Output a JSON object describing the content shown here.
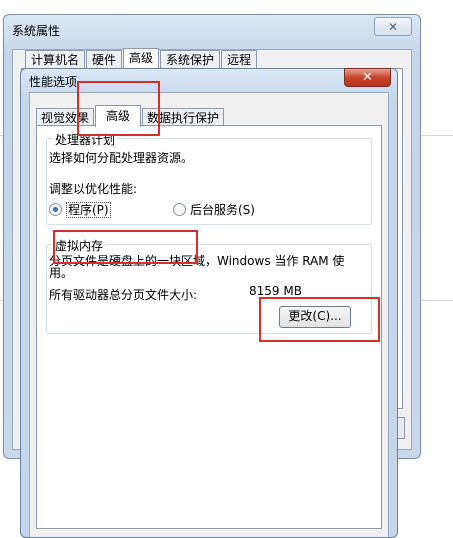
{
  "back_window": {
    "title": "系统属性",
    "close_glyph": "✕",
    "tabs": [
      {
        "label": "计算机名"
      },
      {
        "label": "硬件"
      },
      {
        "label": "高级"
      },
      {
        "label": "系统保护"
      },
      {
        "label": "远程"
      }
    ]
  },
  "front_window": {
    "title": "性能选项",
    "close_glyph": "✕",
    "tabs": [
      {
        "label": "视觉效果"
      },
      {
        "label": "高级"
      },
      {
        "label": "数据执行保护"
      }
    ],
    "processor": {
      "group_title": "处理器计划",
      "description": "选择如何分配处理器资源。",
      "adjust_label": "调整以优化性能:",
      "option_programs": "程序(P)",
      "option_services": "后台服务(S)",
      "selected": "programs"
    },
    "virtual_memory": {
      "group_title": "虚拟内存",
      "description": "分页文件是硬盘上的一块区域，Windows 当作 RAM 使用。",
      "total_label": "所有驱动器总分页文件大小:",
      "total_value": "8159 MB",
      "change_button": "更改(C)..."
    }
  },
  "colors": {
    "highlight": "#d2302a"
  }
}
